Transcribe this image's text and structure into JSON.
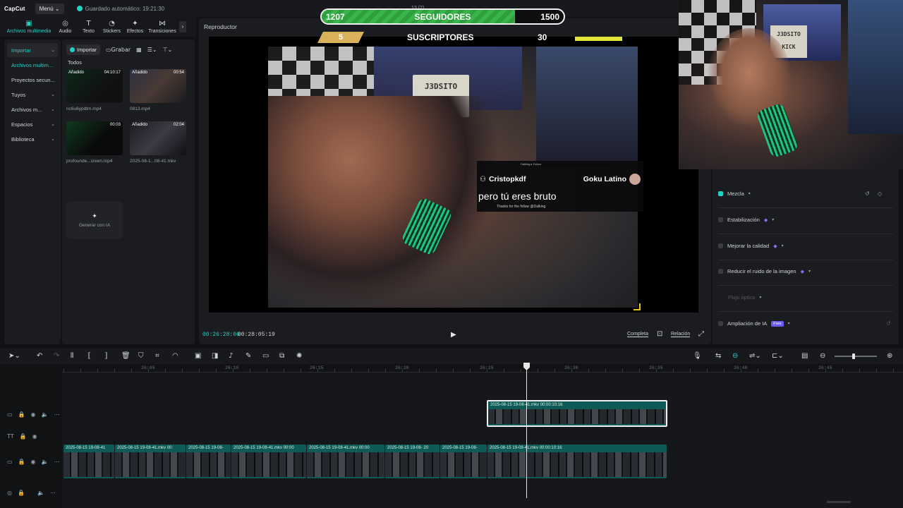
{
  "titlebar": {
    "logo": "CapCut",
    "menu": "Menú ⌄",
    "autosave": "Guardado automático: 19:21:30",
    "project_number": "13 (2)"
  },
  "tooltabs": [
    {
      "icon": "▣",
      "label": "Archivos multimedia",
      "active": true
    },
    {
      "icon": "◎",
      "label": "Audio"
    },
    {
      "icon": "T",
      "label": "Texto"
    },
    {
      "icon": "◔",
      "label": "Stickers"
    },
    {
      "icon": "✦",
      "label": "Efectos"
    },
    {
      "icon": "⋈",
      "label": "Transiciones"
    }
  ],
  "leftnav": [
    {
      "label": "Importar",
      "chev": "⌄",
      "active": true
    },
    {
      "label": "Archivos multim...",
      "highlight": true
    },
    {
      "label": "Proyectos secun..."
    },
    {
      "label": "Tuyos",
      "chev": "⌄"
    },
    {
      "label": "Archivos m...",
      "chev": "⌄"
    },
    {
      "label": "Espacios",
      "chev": "⌄"
    },
    {
      "label": "Biblioteca",
      "chev": "⌄"
    }
  ],
  "media": {
    "import_label": "Importar",
    "record_label": "Grabar",
    "filter_all": "Todos",
    "items": [
      {
        "badge": "Añadido",
        "duration": "04:10:17",
        "name": "nc6u6ypdtm.mp4"
      },
      {
        "badge": "Añadido",
        "duration": "00:54",
        "name": "0813.mp4"
      },
      {
        "badge": "",
        "duration": "00:03",
        "name": "profounde...creen.mp4"
      },
      {
        "badge": "Añadido",
        "duration": "02:04",
        "name": "2025-08-1...08-41.mkv"
      }
    ],
    "generate_ia": "Generar con IA"
  },
  "player": {
    "title": "Reproductor",
    "time_current": "00:26:28:06",
    "time_total": "00:28:05:19",
    "completa": "Completa",
    "relacion": "Relación",
    "sign_text": "J3DSITO\nKICK"
  },
  "stream": {
    "followers_current": "1207",
    "followers_label": "SEGUIDORES",
    "followers_goal": "1500",
    "followers_progress": 0.8,
    "subs_current": "5",
    "subs_label": "SUSCRIPTORES",
    "subs_goal": "30"
  },
  "chat": {
    "top_line": "Dalking ▸ Follow",
    "user": "Cristopkdf",
    "channel": "Goku Latino",
    "message": "pero tú eres bruto",
    "bottom_line": "Thanks for the follow @Dalking"
  },
  "cam": {
    "sign_text": "J3DSITO\nKICK"
  },
  "props": [
    {
      "label": "Mezcla",
      "checked": true
    },
    {
      "label": "Estabilización",
      "gem": true
    },
    {
      "label": "Mejorar la calidad",
      "gem": true
    },
    {
      "label": "Reducir el ruido de la imagen",
      "gem": true
    },
    {
      "label": "Flujo óptico",
      "dim": true
    },
    {
      "label": "Ampliación de IA",
      "free": "Free"
    }
  ],
  "timeline": {
    "ruler_ticks": [
      "26:05",
      "26:10",
      "26:15",
      "26:20",
      "26:25",
      "26:30",
      "26:35",
      "26:40",
      "26:45"
    ],
    "upper_clip": {
      "label": "2025-08-15 19-08-41.mkv   00:00:10:16"
    },
    "lower_clips": [
      {
        "label": "2025-08-15 19-08-41"
      },
      {
        "label": "2025-08-15 19-08-41.mkv  00:"
      },
      {
        "label": "2025-08-15 19-08-"
      },
      {
        "label": "2025-08-15 19-08-41.mkv  00:00"
      },
      {
        "label": "2025-08-15 19-08-41.mkv  00:00"
      },
      {
        "label": "2025-08-15 19-08- 20"
      },
      {
        "label": "2025-08-15 19-08-"
      },
      {
        "label": "2025-08-15 19-08-41.mkv  00:00:10:16"
      }
    ],
    "zoom_level": 0.45
  }
}
